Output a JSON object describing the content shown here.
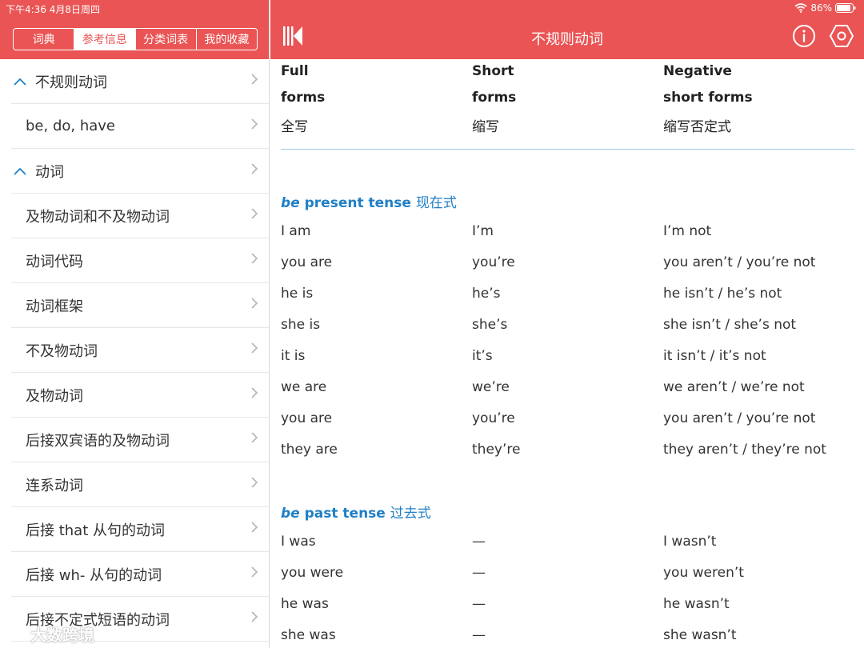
{
  "status_bar": {
    "time_date": "下午4:36   4月8日周四",
    "battery": "86%"
  },
  "left_tabs": [
    {
      "label": "词典",
      "active": false
    },
    {
      "label": "参考信息",
      "active": true
    },
    {
      "label": "分类词表",
      "active": false
    },
    {
      "label": "我的收藏",
      "active": false
    }
  ],
  "nav_items": [
    {
      "label": "不规则动词",
      "expanded": true
    },
    {
      "label": "be, do, have"
    },
    {
      "label": "动词",
      "expanded": true
    },
    {
      "label": "及物动词和不及物动词"
    },
    {
      "label": "动词代码"
    },
    {
      "label": "动词框架"
    },
    {
      "label": "不及物动词"
    },
    {
      "label": "及物动词"
    },
    {
      "label": "后接双宾语的及物动词"
    },
    {
      "label": "连系动词"
    },
    {
      "label": "后接 that 从句的动词"
    },
    {
      "label": "后接 wh- 从句的动词"
    },
    {
      "label": "后接不定式短语的动词"
    }
  ],
  "header": {
    "title": "不规则动词"
  },
  "table_header": {
    "col1": [
      "Full",
      "forms",
      "全写"
    ],
    "col2": [
      "Short",
      "forms",
      "缩写"
    ],
    "col3": [
      "Negative",
      "short forms",
      "缩写否定式"
    ]
  },
  "sections": [
    {
      "title_em": "be",
      "title_rest": " present tense ",
      "title_zh": "现在式",
      "rows": [
        [
          "I am",
          "I’m",
          "I’m not"
        ],
        [
          "you are",
          "you’re",
          "you aren’t / you’re not"
        ],
        [
          "he is",
          "he’s",
          "he isn’t / he’s not"
        ],
        [
          "she is",
          "she’s",
          "she isn’t / she’s not"
        ],
        [
          "it is",
          "it’s",
          "it isn’t / it’s not"
        ],
        [
          "we are",
          "we’re",
          "we aren’t / we’re not"
        ],
        [
          "you are",
          "you’re",
          "you aren’t / you’re not"
        ],
        [
          "they are",
          "they’re",
          "they aren’t / they’re not"
        ]
      ]
    },
    {
      "title_em": "be",
      "title_rest": " past tense ",
      "title_zh": "过去式",
      "rows": [
        [
          "I was",
          "—",
          "I wasn’t"
        ],
        [
          "you were",
          "—",
          "you weren’t"
        ],
        [
          "he was",
          "—",
          "he wasn’t"
        ],
        [
          "she was",
          "—",
          "she wasn’t"
        ]
      ]
    }
  ],
  "watermark": {
    "text": "大数跨境"
  },
  "colors": {
    "header_bg": "#ea5454",
    "section_title": "#1f7fc6",
    "rule": "#9cc9e0"
  }
}
